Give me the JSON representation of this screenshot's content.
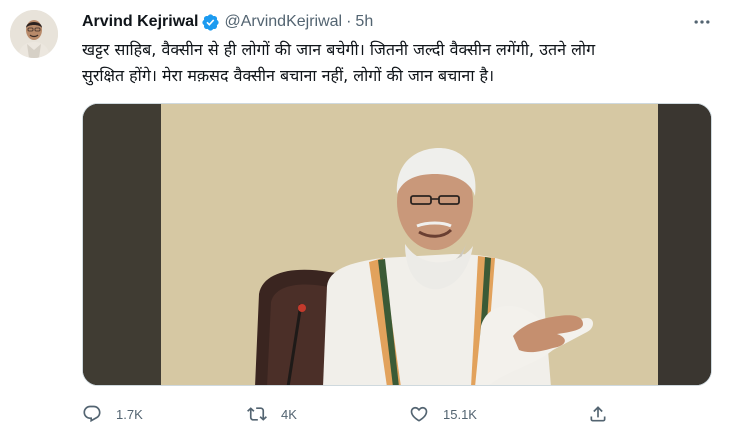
{
  "tweet": {
    "author": {
      "name": "Arvind Kejriwal",
      "handle": "@ArvindKejriwal",
      "verified": true
    },
    "separator": "·",
    "time": "5h",
    "text_lines": [
      "खट्टर साहिब, वैक्सीन से ही लोगों की जान बचेगी। जितनी जल्दी वैक्सीन लगेंगी, उतने लोग",
      "सुरक्षित होंगे। मेरा मक़सद वैक्सीन बचाना नहीं, लोगों की जान बचाना है।"
    ],
    "media": {
      "type": "video"
    },
    "actions": {
      "reply": {
        "icon": "reply-icon",
        "count": "1.7K"
      },
      "retweet": {
        "icon": "retweet-icon",
        "count": "4K"
      },
      "like": {
        "icon": "heart-icon",
        "count": "15.1K"
      },
      "share": {
        "icon": "share-icon"
      }
    }
  },
  "colors": {
    "text": "#0f1419",
    "secondary": "#536471",
    "verified": "#1d9bf0",
    "border": "#cfd9de"
  }
}
